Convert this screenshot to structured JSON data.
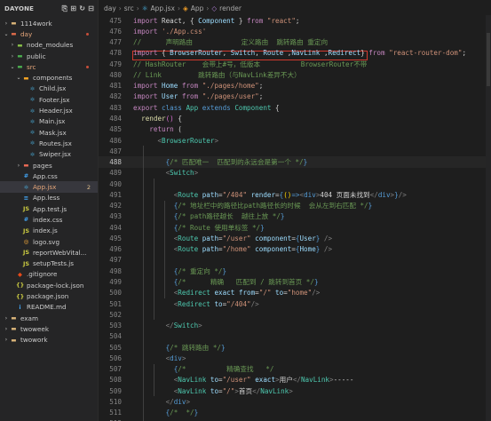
{
  "explorer": {
    "title": "DAYONE",
    "actions": [
      "new-file-icon",
      "new-folder-icon",
      "refresh-icon",
      "collapse-icon"
    ],
    "items": [
      {
        "depth": 0,
        "type": "folder",
        "open": false,
        "label": "1114work",
        "icon_color": "#dcb67a"
      },
      {
        "depth": 0,
        "type": "folder",
        "open": true,
        "label": "day",
        "icon_color": "#e06c4a",
        "label_color": "#e5a67a",
        "dot": true
      },
      {
        "depth": 1,
        "type": "folder",
        "open": false,
        "label": "node_modules",
        "icon_color": "#8bc34a"
      },
      {
        "depth": 1,
        "type": "folder",
        "open": false,
        "label": "public",
        "icon_color": "#4caf50"
      },
      {
        "depth": 1,
        "type": "folder",
        "open": true,
        "label": "src",
        "icon_color": "#4caf50",
        "label_color": "#e5a67a",
        "dot": true
      },
      {
        "depth": 2,
        "type": "folder",
        "open": true,
        "label": "components",
        "icon_color": "#f9a825"
      },
      {
        "depth": 3,
        "type": "file",
        "label": "Child.jsx",
        "glyph": "⚛",
        "icon_color": "#4fc3f7"
      },
      {
        "depth": 3,
        "type": "file",
        "label": "Footer.jsx",
        "glyph": "⚛",
        "icon_color": "#4fc3f7"
      },
      {
        "depth": 3,
        "type": "file",
        "label": "Header.jsx",
        "glyph": "⚛",
        "icon_color": "#4fc3f7"
      },
      {
        "depth": 3,
        "type": "file",
        "label": "Main.jsx",
        "glyph": "⚛",
        "icon_color": "#4fc3f7"
      },
      {
        "depth": 3,
        "type": "file",
        "label": "Mask.jsx",
        "glyph": "⚛",
        "icon_color": "#4fc3f7"
      },
      {
        "depth": 3,
        "type": "file",
        "label": "Routes.jsx",
        "glyph": "⚛",
        "icon_color": "#4fc3f7"
      },
      {
        "depth": 3,
        "type": "file",
        "label": "Swiper.jsx",
        "glyph": "⚛",
        "icon_color": "#4fc3f7"
      },
      {
        "depth": 2,
        "type": "folder",
        "open": false,
        "label": "pages",
        "icon_color": "#ef6c57"
      },
      {
        "depth": 2,
        "type": "file",
        "label": "App.css",
        "glyph": "#",
        "icon_color": "#42a5f5"
      },
      {
        "depth": 2,
        "type": "file",
        "label": "App.jsx",
        "glyph": "⚛",
        "icon_color": "#4fc3f7",
        "label_color": "#e5a67a",
        "badge": "2",
        "selected": true
      },
      {
        "depth": 2,
        "type": "file",
        "label": "App.less",
        "glyph": "≡",
        "icon_color": "#42a5f5"
      },
      {
        "depth": 2,
        "type": "file",
        "label": "App.test.js",
        "glyph": "JS",
        "icon_color": "#cbcb41"
      },
      {
        "depth": 2,
        "type": "file",
        "label": "index.css",
        "glyph": "#",
        "icon_color": "#42a5f5"
      },
      {
        "depth": 2,
        "type": "file",
        "label": "index.js",
        "glyph": "JS",
        "icon_color": "#cbcb41"
      },
      {
        "depth": 2,
        "type": "file",
        "label": "logo.svg",
        "glyph": "◎",
        "icon_color": "#ffb13b"
      },
      {
        "depth": 2,
        "type": "file",
        "label": "reportWebVital...",
        "glyph": "JS",
        "icon_color": "#cbcb41"
      },
      {
        "depth": 2,
        "type": "file",
        "label": "setupTests.js",
        "glyph": "JS",
        "icon_color": "#cbcb41"
      },
      {
        "depth": 1,
        "type": "file",
        "label": ".gitignore",
        "glyph": "◆",
        "icon_color": "#e64a19"
      },
      {
        "depth": 1,
        "type": "file",
        "label": "package-lock.json",
        "glyph": "{}",
        "icon_color": "#cbcb41"
      },
      {
        "depth": 1,
        "type": "file",
        "label": "package.json",
        "glyph": "{}",
        "icon_color": "#cbcb41"
      },
      {
        "depth": 1,
        "type": "file",
        "label": "README.md",
        "glyph": "i",
        "icon_color": "#42a5f5"
      },
      {
        "depth": 0,
        "type": "folder",
        "open": false,
        "label": "exam",
        "icon_color": "#dcb67a"
      },
      {
        "depth": 0,
        "type": "folder",
        "open": false,
        "label": "twoweek",
        "icon_color": "#dcb67a"
      },
      {
        "depth": 0,
        "type": "folder",
        "open": false,
        "label": "twowork",
        "icon_color": "#dcb67a"
      }
    ]
  },
  "breadcrumb": [
    "day",
    "src",
    "App.jsx",
    "App",
    "render"
  ],
  "editor": {
    "current_line": 488,
    "lines": [
      {
        "n": 475,
        "t": [
          [
            "kw",
            "import"
          ],
          [
            "tx",
            " React, { "
          ],
          [
            "vr",
            "Component"
          ],
          [
            "tx",
            " } "
          ],
          [
            "kw",
            "from"
          ],
          [
            "str",
            " \"react\""
          ],
          [
            "tx",
            ";"
          ]
        ]
      },
      {
        "n": 476,
        "t": [
          [
            "kw",
            "import"
          ],
          [
            "str",
            " './App.css'"
          ]
        ]
      },
      {
        "n": 477,
        "t": [
          [
            "cm",
            "//      声明路由            定义路由  跳转路由 重定向"
          ]
        ]
      },
      {
        "n": 478,
        "t": [
          [
            "kw",
            "import"
          ],
          [
            "tx",
            " { "
          ],
          [
            "vr",
            "BrowserRouter"
          ],
          [
            "tx",
            ", "
          ],
          [
            "vr",
            "Switch"
          ],
          [
            "tx",
            ", "
          ],
          [
            "vr",
            "Route"
          ],
          [
            "tx",
            " ,"
          ],
          [
            "vr",
            "NavLink"
          ],
          [
            "tx",
            " ,"
          ],
          [
            "vr",
            "Redirect"
          ],
          [
            "tx",
            "} "
          ],
          [
            "kw",
            "from"
          ],
          [
            "str",
            " \"react-router-dom\""
          ],
          [
            "tx",
            ";"
          ]
        ]
      },
      {
        "n": 479,
        "t": [
          [
            "cm",
            "// HashRouter    会带上#号，低版本          BrowserRouter不带"
          ]
        ]
      },
      {
        "n": 480,
        "t": [
          [
            "cm",
            "// Link         跳转路由（与NavLink差异不大）"
          ]
        ]
      },
      {
        "n": 481,
        "t": [
          [
            "kw",
            "import"
          ],
          [
            "vr",
            " Home"
          ],
          [
            "kw",
            " from"
          ],
          [
            "str",
            " \"./pages/home\""
          ],
          [
            "tx",
            ";"
          ]
        ]
      },
      {
        "n": 482,
        "t": [
          [
            "kw",
            "import"
          ],
          [
            "vr",
            " User"
          ],
          [
            "kw",
            " from"
          ],
          [
            "str",
            " \"./pages/user\""
          ],
          [
            "tx",
            ";"
          ]
        ]
      },
      {
        "n": 483,
        "t": [
          [
            "kw",
            "export"
          ],
          [
            "kb",
            " class"
          ],
          [
            "cl",
            " App"
          ],
          [
            "kb",
            " extends"
          ],
          [
            "cl",
            " Component"
          ],
          [
            "tx",
            " {"
          ]
        ]
      },
      {
        "n": 484,
        "t": [
          [
            "tx",
            "  "
          ],
          [
            "fn",
            "render"
          ],
          [
            "br2",
            "()"
          ],
          [
            "tx",
            " {"
          ]
        ]
      },
      {
        "n": 485,
        "t": [
          [
            "tx",
            "    "
          ],
          [
            "kw",
            "return"
          ],
          [
            "tx",
            " ("
          ]
        ]
      },
      {
        "n": 486,
        "t": [
          [
            "tx",
            "      "
          ],
          [
            "pn",
            "<"
          ],
          [
            "tg",
            "BrowserRouter"
          ],
          [
            "pn",
            ">"
          ]
        ]
      },
      {
        "n": 487,
        "t": []
      },
      {
        "n": 488,
        "t": [
          [
            "tx",
            "        "
          ],
          [
            "kb",
            "{"
          ],
          [
            "cm",
            "/* 匹配唯一  匹配到的永远会是第一个 */"
          ],
          [
            "kb",
            "}"
          ]
        ]
      },
      {
        "n": 489,
        "t": [
          [
            "tx",
            "        "
          ],
          [
            "pn",
            "<"
          ],
          [
            "tg",
            "Switch"
          ],
          [
            "pn",
            ">"
          ]
        ]
      },
      {
        "n": 490,
        "t": []
      },
      {
        "n": 491,
        "t": [
          [
            "tx",
            "          "
          ],
          [
            "pn",
            "<"
          ],
          [
            "tg",
            "Route"
          ],
          [
            "at",
            " path"
          ],
          [
            "tx",
            "="
          ],
          [
            "str",
            "\"/404\""
          ],
          [
            "at",
            " render"
          ],
          [
            "tx",
            "="
          ],
          [
            "kb",
            "{"
          ],
          [
            "br",
            "()"
          ],
          [
            "kb",
            "=>"
          ],
          [
            "pn",
            "<"
          ],
          [
            "kb",
            "div"
          ],
          [
            "pn",
            ">"
          ],
          [
            "tx",
            "404 页面未找到"
          ],
          [
            "pn",
            "</"
          ],
          [
            "kb",
            "div"
          ],
          [
            "pn",
            ">"
          ],
          [
            "kb",
            "}"
          ],
          [
            "pn",
            "/>"
          ]
        ]
      },
      {
        "n": 492,
        "t": [
          [
            "tx",
            "          "
          ],
          [
            "kb",
            "{"
          ],
          [
            "cm",
            "/* 地址栏中的路径比path路径长的时候  会从左到右匹配 */"
          ],
          [
            "kb",
            "}"
          ]
        ]
      },
      {
        "n": 493,
        "t": [
          [
            "tx",
            "          "
          ],
          [
            "kb",
            "{"
          ],
          [
            "cm",
            "/* path路径越长  越往上放 */"
          ],
          [
            "kb",
            "}"
          ]
        ]
      },
      {
        "n": 494,
        "t": [
          [
            "tx",
            "          "
          ],
          [
            "kb",
            "{"
          ],
          [
            "cm",
            "/* Route 使用单标签 */"
          ],
          [
            "kb",
            "}"
          ]
        ]
      },
      {
        "n": 495,
        "t": [
          [
            "tx",
            "          "
          ],
          [
            "pn",
            "<"
          ],
          [
            "tg",
            "Route"
          ],
          [
            "at",
            " path"
          ],
          [
            "tx",
            "="
          ],
          [
            "str",
            "\"/user\""
          ],
          [
            "at",
            " component"
          ],
          [
            "tx",
            "="
          ],
          [
            "kb",
            "{"
          ],
          [
            "vr",
            "User"
          ],
          [
            "kb",
            "}"
          ],
          [
            "pn",
            " />"
          ]
        ]
      },
      {
        "n": 496,
        "t": [
          [
            "tx",
            "          "
          ],
          [
            "pn",
            "<"
          ],
          [
            "tg",
            "Route"
          ],
          [
            "at",
            " path"
          ],
          [
            "tx",
            "="
          ],
          [
            "str",
            "\"/home\""
          ],
          [
            "at",
            " component"
          ],
          [
            "tx",
            "="
          ],
          [
            "kb",
            "{"
          ],
          [
            "vr",
            "Home"
          ],
          [
            "kb",
            "}"
          ],
          [
            "pn",
            " />"
          ]
        ]
      },
      {
        "n": 497,
        "t": []
      },
      {
        "n": 498,
        "t": [
          [
            "tx",
            "          "
          ],
          [
            "kb",
            "{"
          ],
          [
            "cm",
            "/* 重定向 */"
          ],
          [
            "kb",
            "}"
          ]
        ]
      },
      {
        "n": 499,
        "t": [
          [
            "tx",
            "          "
          ],
          [
            "kb",
            "{"
          ],
          [
            "cm",
            "/*      精确   匹配到 / 跳转到首页 */"
          ],
          [
            "kb",
            "}"
          ]
        ]
      },
      {
        "n": 500,
        "t": [
          [
            "tx",
            "          "
          ],
          [
            "pn",
            "<"
          ],
          [
            "tg",
            "Redirect"
          ],
          [
            "at",
            " exact"
          ],
          [
            "at",
            " from"
          ],
          [
            "tx",
            "="
          ],
          [
            "str",
            "\"/\""
          ],
          [
            "at",
            " to"
          ],
          [
            "tx",
            "="
          ],
          [
            "str",
            "\"home\""
          ],
          [
            "pn",
            "/>"
          ]
        ]
      },
      {
        "n": 501,
        "t": [
          [
            "tx",
            "          "
          ],
          [
            "pn",
            "<"
          ],
          [
            "tg",
            "Redirect"
          ],
          [
            "at",
            " to"
          ],
          [
            "tx",
            "="
          ],
          [
            "str",
            "\"/404\""
          ],
          [
            "pn",
            "/>"
          ]
        ]
      },
      {
        "n": 502,
        "t": []
      },
      {
        "n": 503,
        "t": [
          [
            "tx",
            "        "
          ],
          [
            "pn",
            "</"
          ],
          [
            "tg",
            "Switch"
          ],
          [
            "pn",
            ">"
          ]
        ]
      },
      {
        "n": 504,
        "t": []
      },
      {
        "n": 505,
        "t": [
          [
            "tx",
            "        "
          ],
          [
            "kb",
            "{"
          ],
          [
            "cm",
            "/* 跳转路由 */"
          ],
          [
            "kb",
            "}"
          ]
        ]
      },
      {
        "n": 506,
        "t": [
          [
            "tx",
            "        "
          ],
          [
            "pn",
            "<"
          ],
          [
            "kb",
            "div"
          ],
          [
            "pn",
            ">"
          ]
        ]
      },
      {
        "n": 507,
        "t": [
          [
            "tx",
            "          "
          ],
          [
            "kb",
            "{"
          ],
          [
            "cm",
            "/*          精确查找   */"
          ]
        ]
      },
      {
        "n": 508,
        "t": [
          [
            "tx",
            "          "
          ],
          [
            "pn",
            "<"
          ],
          [
            "tg",
            "NavLink"
          ],
          [
            "at",
            " to"
          ],
          [
            "tx",
            "="
          ],
          [
            "str",
            "\"/user\""
          ],
          [
            "at",
            " exact"
          ],
          [
            "pn",
            ">"
          ],
          [
            "tx",
            "用户"
          ],
          [
            "pn",
            "</"
          ],
          [
            "tg",
            "NavLink"
          ],
          [
            "pn",
            ">"
          ],
          [
            "tx",
            "-----"
          ]
        ]
      },
      {
        "n": 509,
        "t": [
          [
            "tx",
            "          "
          ],
          [
            "pn",
            "<"
          ],
          [
            "tg",
            "NavLink"
          ],
          [
            "at",
            " to"
          ],
          [
            "tx",
            "="
          ],
          [
            "str",
            "\"/\""
          ],
          [
            "pn",
            ">"
          ],
          [
            "tx",
            "首页"
          ],
          [
            "pn",
            "</"
          ],
          [
            "tg",
            "NavLink"
          ],
          [
            "pn",
            ">"
          ]
        ]
      },
      {
        "n": 510,
        "t": [
          [
            "tx",
            "        "
          ],
          [
            "pn",
            "</"
          ],
          [
            "kb",
            "div"
          ],
          [
            "pn",
            ">"
          ]
        ]
      },
      {
        "n": 511,
        "t": [
          [
            "tx",
            "        "
          ],
          [
            "kb",
            "{"
          ],
          [
            "cm",
            "/*  */"
          ],
          [
            "kb",
            "}"
          ]
        ]
      },
      {
        "n": 512,
        "t": []
      },
      {
        "n": 513,
        "t": [
          [
            "tx",
            "      "
          ],
          [
            "pn",
            "</"
          ],
          [
            "tg",
            "BrowserRouter"
          ],
          [
            "pn",
            ">"
          ]
        ]
      }
    ]
  }
}
